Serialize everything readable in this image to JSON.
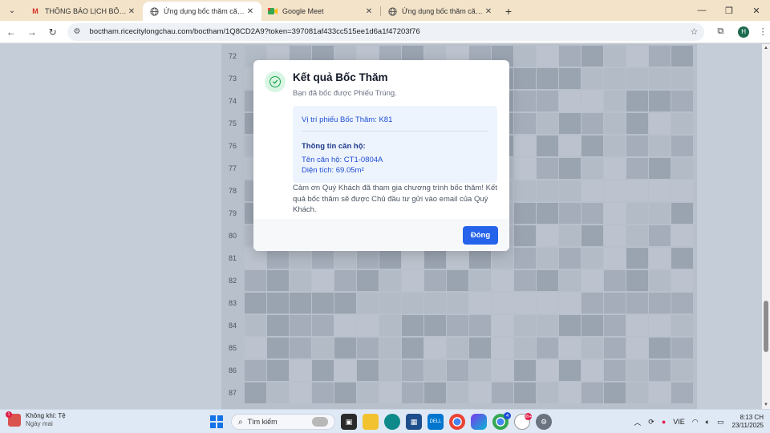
{
  "browser": {
    "tabs": [
      {
        "title": "THÔNG BÁO LỊCH BỐC THĂM",
        "favicon": "gmail-icon",
        "active": false
      },
      {
        "title": "Ứng dụng bốc thăm căn hộ dự",
        "favicon": "globe-icon",
        "active": true
      },
      {
        "title": "Google Meet",
        "favicon": "meet-icon",
        "active": false
      },
      {
        "title": "Ứng dụng bốc thăm căn hộ dự",
        "favicon": "globe-icon",
        "active": false
      }
    ],
    "url": "boctham.ricecitylongchau.com/boctham/1Q8CD2A9?token=397081af433cc515ee1d6a1f47203f76",
    "profile_initial": "H"
  },
  "grid": {
    "row_numbers": [
      "72",
      "73",
      "74",
      "75",
      "76",
      "77",
      "78",
      "79",
      "80",
      "81",
      "82",
      "83",
      "84",
      "85",
      "86",
      "87"
    ]
  },
  "modal": {
    "title": "Kết quả Bốc Thăm",
    "subtitle": "Bạn đã bốc được Phiếu Trúng.",
    "position_line": "Vị trí phiếu Bốc Thăm: K81",
    "apartment_heading": "Thông tin căn hộ:",
    "apartment_name": "Tên căn hộ: CT1-0804A",
    "apartment_area": "Diện tích: 69.05m²",
    "thanks": "Cảm ơn Quý Khách đã tham gia chương trình bốc thăm! Kết quả bốc thăm sẽ được Chủ đầu tư gửi vào email của Quý Khách.",
    "close_label": "Đóng",
    "accent_color": "#2563eb",
    "success_color": "#16a34a"
  },
  "taskbar": {
    "weather_title": "Không khí: Tệ",
    "weather_sub": "Ngày mai",
    "weather_badge": "1",
    "search_label": "Tìm kiếm",
    "chrome_badge": "4",
    "app_badge": "99+",
    "language": "VIE",
    "time": "8:13 CH",
    "date": "23/11/2025"
  }
}
